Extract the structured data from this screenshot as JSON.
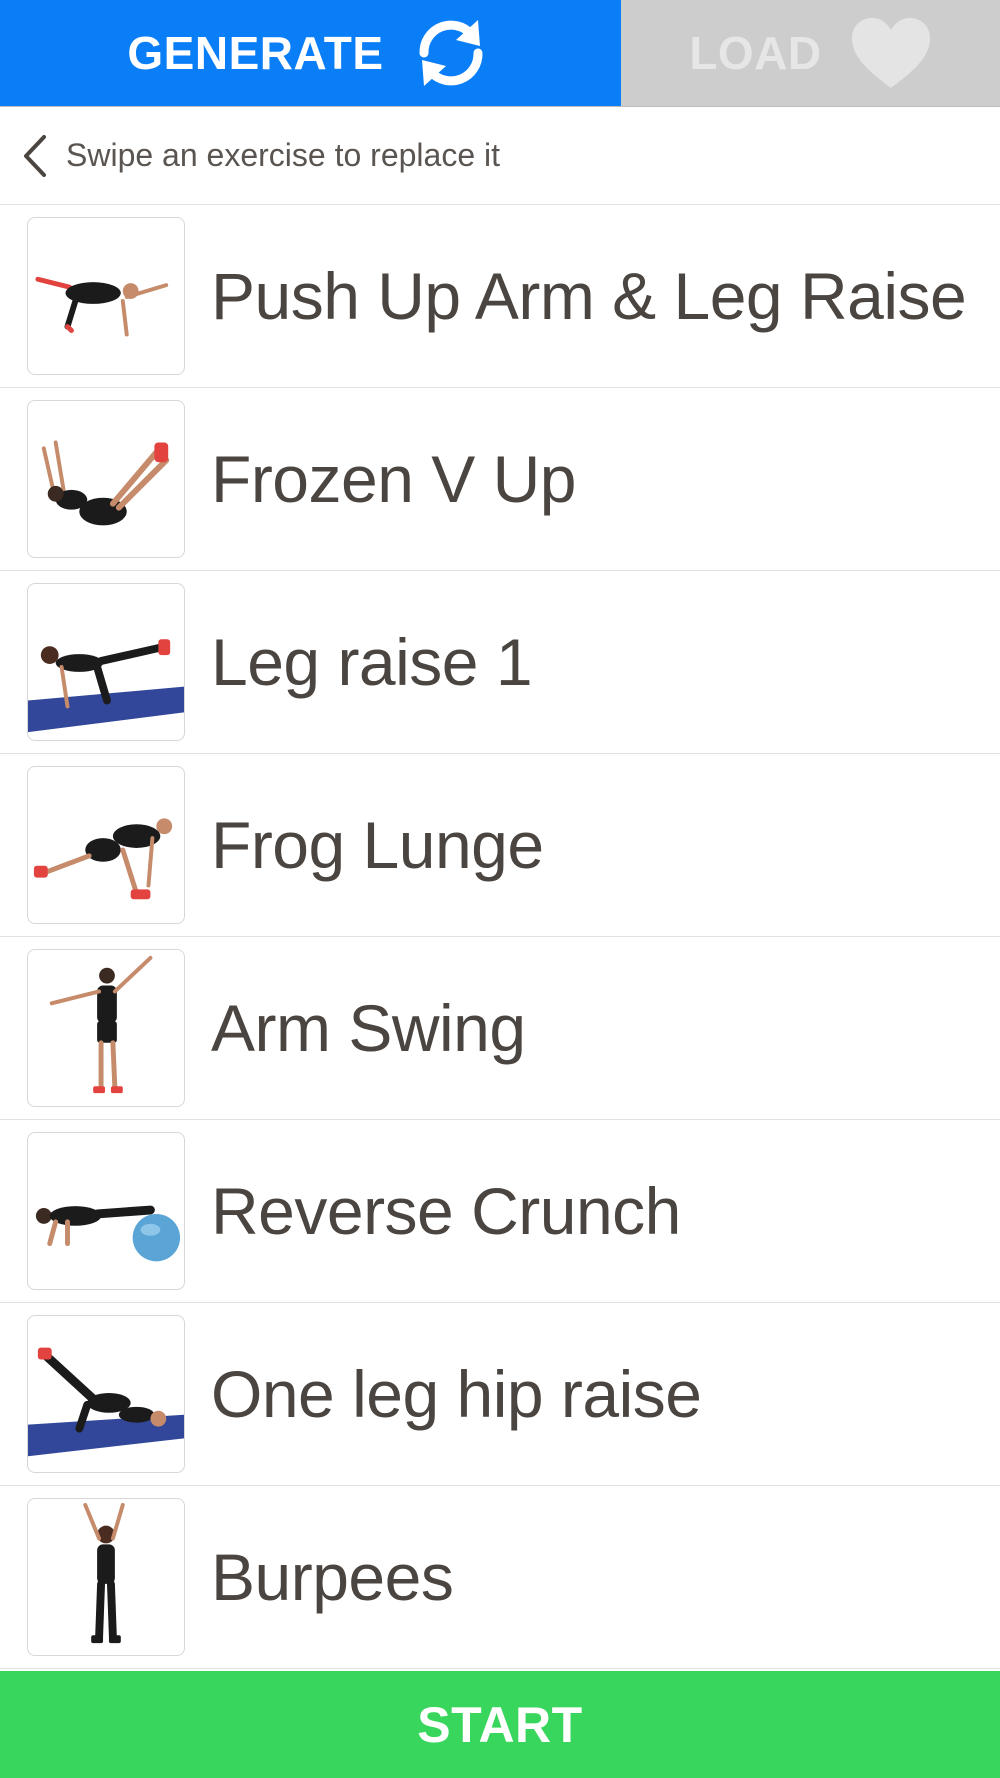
{
  "colors": {
    "generate_tab": "#0a7ef7",
    "load_tab": "#cdcdcd",
    "start_button": "#38d65c",
    "title_text": "#4a4540"
  },
  "tabs": {
    "generate": {
      "label": "GENERATE",
      "icon": "refresh-icon",
      "active": true
    },
    "load": {
      "label": "LOAD",
      "icon": "heart-icon",
      "active": false
    }
  },
  "hint": {
    "icon": "chevron-left-icon",
    "text": "Swipe an exercise to replace it"
  },
  "exercises": [
    {
      "name": "Push Up Arm & Leg Raise",
      "icon": "push-up-arm-leg-raise-thumbnail"
    },
    {
      "name": "Frozen V Up",
      "icon": "frozen-v-up-thumbnail"
    },
    {
      "name": "Leg raise 1",
      "icon": "leg-raise-thumbnail"
    },
    {
      "name": "Frog Lunge",
      "icon": "frog-lunge-thumbnail"
    },
    {
      "name": "Arm Swing",
      "icon": "arm-swing-thumbnail"
    },
    {
      "name": "Reverse Crunch",
      "icon": "reverse-crunch-thumbnail"
    },
    {
      "name": "One leg hip raise",
      "icon": "one-leg-hip-raise-thumbnail"
    },
    {
      "name": "Burpees",
      "icon": "burpees-thumbnail"
    }
  ],
  "start": {
    "label": "START"
  }
}
